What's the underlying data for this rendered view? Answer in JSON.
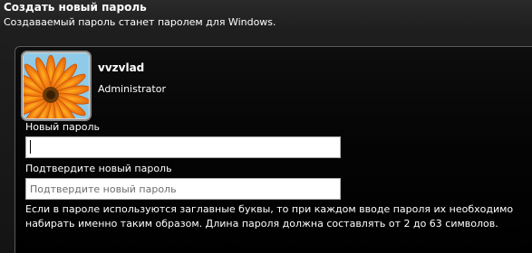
{
  "header": {
    "title": "Создать новый пароль",
    "subtitle": "Создаваемый пароль станет паролем для Windows."
  },
  "user": {
    "name": "vvzvlad",
    "role": "Administrator",
    "avatar_icon": "orange-flower-icon"
  },
  "fields": {
    "new_password": {
      "label": "Новый пароль",
      "value": "",
      "placeholder": ""
    },
    "confirm_password": {
      "label": "Подтвердите новый пароль",
      "value": "",
      "placeholder": "Подтвердите новый пароль"
    }
  },
  "hint": "Если в пароле используются заглавные буквы, то при каждом вводе пароля их необходимо набирать именно таким образом. Длина пароля должна составлять от 2 до 63 символов.",
  "colors": {
    "background": "#141414",
    "panel_border": "#5a5a5a",
    "text": "#ffffff",
    "input_border": "#adadad"
  }
}
